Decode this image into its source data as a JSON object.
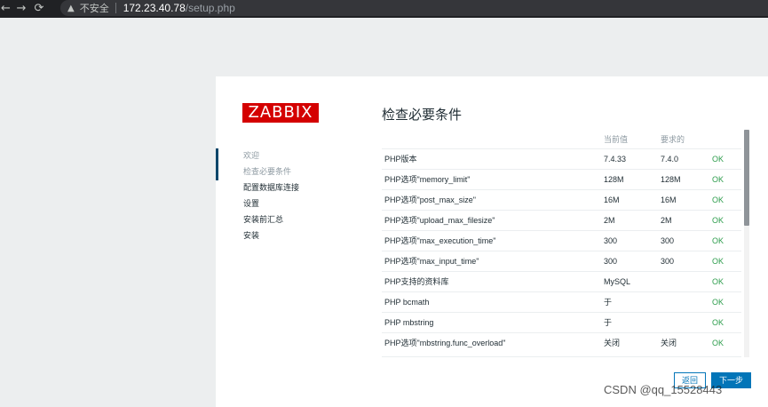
{
  "browser": {
    "insecure_label": "不安全",
    "url_host": "172.23.40.78",
    "url_path": "/setup.php"
  },
  "logo": "ZABBIX",
  "sidebar": {
    "steps": [
      {
        "label": "欢迎",
        "state": "done"
      },
      {
        "label": "检查必要条件",
        "state": "current"
      },
      {
        "label": "配置数据库连接",
        "state": "pending"
      },
      {
        "label": "设置",
        "state": "pending"
      },
      {
        "label": "安装前汇总",
        "state": "pending"
      },
      {
        "label": "安装",
        "state": "pending"
      }
    ]
  },
  "main": {
    "title": "检查必要条件",
    "columns": [
      "",
      "当前值",
      "要求的",
      ""
    ],
    "rows": [
      [
        "PHP版本",
        "7.4.33",
        "7.4.0",
        "OK"
      ],
      [
        "PHP选项\"memory_limit\"",
        "128M",
        "128M",
        "OK"
      ],
      [
        "PHP选项\"post_max_size\"",
        "16M",
        "16M",
        "OK"
      ],
      [
        "PHP选项\"upload_max_filesize\"",
        "2M",
        "2M",
        "OK"
      ],
      [
        "PHP选项\"max_execution_time\"",
        "300",
        "300",
        "OK"
      ],
      [
        "PHP选项\"max_input_time\"",
        "300",
        "300",
        "OK"
      ],
      [
        "PHP支持的资料库",
        "MySQL",
        "",
        "OK"
      ],
      [
        "PHP bcmath",
        "于",
        "",
        "OK"
      ],
      [
        "PHP mbstring",
        "于",
        "",
        "OK"
      ],
      [
        "PHP选项\"mbstring.func_overload\"",
        "关闭",
        "关闭",
        "OK"
      ]
    ],
    "back_label": "返回",
    "next_label": "下一步"
  },
  "colors": {
    "logo_bg": "#d40000",
    "ok": "#2e9d4d",
    "primary": "#0275b8",
    "current_marker": "#0a466a"
  },
  "watermark": "CSDN @qq_15528443"
}
